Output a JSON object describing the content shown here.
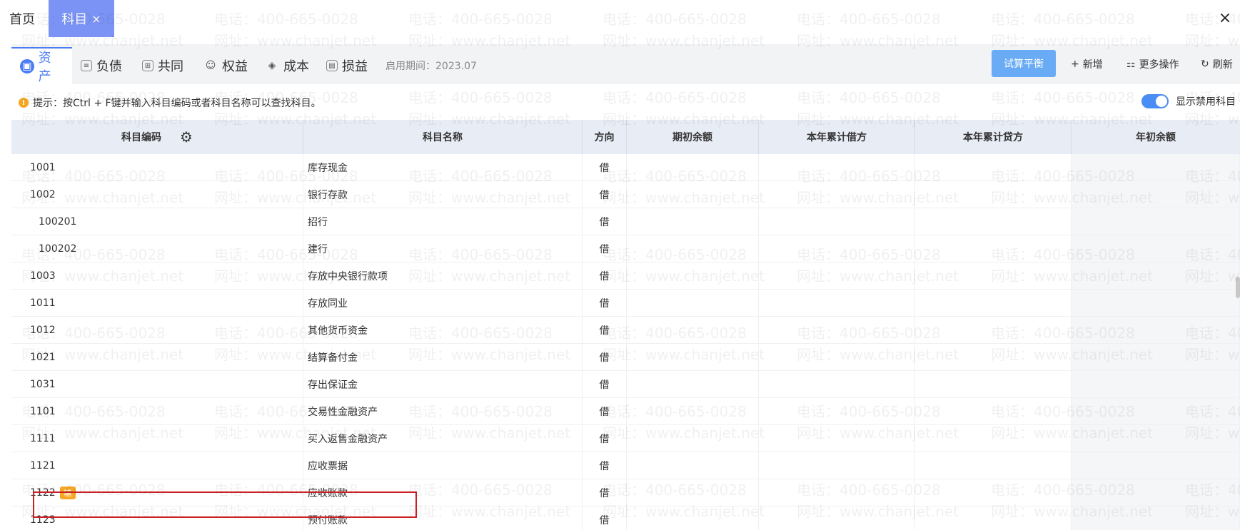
{
  "tabs": {
    "home": "首页",
    "active": "科目",
    "active_close": "×"
  },
  "window_close": "×",
  "categories": [
    {
      "label": "资产",
      "icon": "asset-icon"
    },
    {
      "label": "负债",
      "icon": "liability-icon"
    },
    {
      "label": "共同",
      "icon": "common-icon"
    },
    {
      "label": "权益",
      "icon": "equity-icon"
    },
    {
      "label": "成本",
      "icon": "cost-icon"
    },
    {
      "label": "损益",
      "icon": "profit-loss-icon"
    }
  ],
  "period": "启用期间：2023.07",
  "actions": {
    "trial_balance": "试算平衡",
    "add": "新增",
    "more": "更多操作",
    "refresh": "刷新"
  },
  "hint": "提示：按Ctrl + F键并输入科目编码或者科目名称可以查找科目。",
  "toggle_label": "显示禁用科目",
  "columns": {
    "code": "科目编码",
    "name": "科目名称",
    "direction": "方向",
    "opening": "期初余额",
    "debit": "本年累计借方",
    "credit": "本年累计贷方",
    "year_begin": "年初余额"
  },
  "rows": [
    {
      "code": "1001",
      "name": "库存现金",
      "dir": "借",
      "sub": false
    },
    {
      "code": "1002",
      "name": "银行存款",
      "dir": "借",
      "sub": false
    },
    {
      "code": "100201",
      "name": "招行",
      "dir": "借",
      "sub": true
    },
    {
      "code": "100202",
      "name": "建行",
      "dir": "借",
      "sub": true
    },
    {
      "code": "1003",
      "name": "存放中央银行款项",
      "dir": "借",
      "sub": false
    },
    {
      "code": "1011",
      "name": "存放同业",
      "dir": "借",
      "sub": false
    },
    {
      "code": "1012",
      "name": "其他货币资金",
      "dir": "借",
      "sub": false
    },
    {
      "code": "1021",
      "name": "结算备付金",
      "dir": "借",
      "sub": false
    },
    {
      "code": "1031",
      "name": "存出保证金",
      "dir": "借",
      "sub": false
    },
    {
      "code": "1101",
      "name": "交易性金融资产",
      "dir": "借",
      "sub": false
    },
    {
      "code": "1111",
      "name": "买入返售金融资产",
      "dir": "借",
      "sub": false
    },
    {
      "code": "1121",
      "name": "应收票据",
      "dir": "借",
      "sub": false
    },
    {
      "code": "1122",
      "name": "应收账款",
      "dir": "借",
      "sub": false,
      "badge": "辅"
    },
    {
      "code": "1123",
      "name": "预付账款",
      "dir": "借",
      "sub": false
    }
  ],
  "watermark": {
    "phone": "电话：400-665-0028",
    "site": "网址：www.chanjet.net"
  }
}
